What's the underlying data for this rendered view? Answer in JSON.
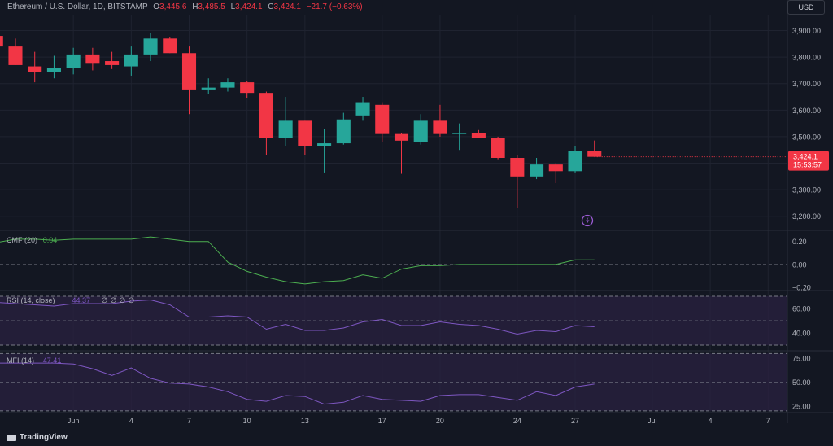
{
  "header": {
    "symbol": "Ethereum / U.S. Dollar, 1D, BITSTAMP",
    "o_label": "O",
    "o": "3,445.6",
    "h_label": "H",
    "h": "3,485.5",
    "l_label": "L",
    "l": "3,424.1",
    "c_label": "C",
    "c": "3,424.1",
    "change": "−21.7 (−0.63%)"
  },
  "currency_button": "USD",
  "branding": "TradingView",
  "price_tag": {
    "price": "3,424.1",
    "countdown": "15:53:57"
  },
  "colors": {
    "up": "#26a69a",
    "down": "#f23645",
    "bg": "#131722",
    "grid": "#1f2330",
    "text": "#b2b5be",
    "indicator_line": "#7e57c2",
    "cmf_line": "#4caf50",
    "band_fill": "#2a2140"
  },
  "chart_data": [
    {
      "type": "candlestick",
      "title": "Ethereum / U.S. Dollar, 1D, BITSTAMP",
      "ylim": [
        3150,
        3960
      ],
      "y_ticks": [
        3200,
        3300,
        3400,
        3500,
        3600,
        3700,
        3800,
        3900
      ],
      "y_tick_labels": [
        "3,200.00",
        "3,300.00",
        "3,400.00",
        "3,500.00",
        "3,600.00",
        "3,700.00",
        "3,800.00",
        "3,900.00"
      ],
      "x_tick_labels": [
        {
          "day": 1,
          "label": "Jun"
        },
        {
          "day": 4,
          "label": "4"
        },
        {
          "day": 7,
          "label": "7"
        },
        {
          "day": 10,
          "label": "10"
        },
        {
          "day": 13,
          "label": "13"
        },
        {
          "day": 17,
          "label": "17"
        },
        {
          "day": 20,
          "label": "20"
        },
        {
          "day": 24,
          "label": "24"
        },
        {
          "day": 27,
          "label": "27"
        },
        {
          "day": 31,
          "label": "Jul"
        },
        {
          "day": 34,
          "label": "4"
        },
        {
          "day": 37,
          "label": "7"
        }
      ],
      "x_range_days": [
        -2.8,
        38
      ],
      "candles": [
        {
          "day": -3,
          "o": 3880,
          "h": 3900,
          "l": 3830,
          "c": 3840
        },
        {
          "day": -2,
          "o": 3840,
          "h": 3870,
          "l": 3770,
          "c": 3770
        },
        {
          "day": -1,
          "o": 3765,
          "h": 3820,
          "l": 3705,
          "c": 3745
        },
        {
          "day": 0,
          "o": 3745,
          "h": 3805,
          "l": 3720,
          "c": 3760
        },
        {
          "day": 1,
          "o": 3760,
          "h": 3835,
          "l": 3735,
          "c": 3810
        },
        {
          "day": 2,
          "o": 3810,
          "h": 3835,
          "l": 3750,
          "c": 3775
        },
        {
          "day": 3,
          "o": 3785,
          "h": 3820,
          "l": 3755,
          "c": 3770
        },
        {
          "day": 4,
          "o": 3765,
          "h": 3840,
          "l": 3730,
          "c": 3810
        },
        {
          "day": 5,
          "o": 3810,
          "h": 3890,
          "l": 3785,
          "c": 3870
        },
        {
          "day": 6,
          "o": 3870,
          "h": 3875,
          "l": 3815,
          "c": 3815
        },
        {
          "day": 7,
          "o": 3815,
          "h": 3840,
          "l": 3585,
          "c": 3678
        },
        {
          "day": 8,
          "o": 3678,
          "h": 3720,
          "l": 3660,
          "c": 3685
        },
        {
          "day": 9,
          "o": 3685,
          "h": 3720,
          "l": 3670,
          "c": 3705
        },
        {
          "day": 10,
          "o": 3705,
          "h": 3710,
          "l": 3645,
          "c": 3665
        },
        {
          "day": 11,
          "o": 3665,
          "h": 3670,
          "l": 3430,
          "c": 3495
        },
        {
          "day": 12,
          "o": 3495,
          "h": 3650,
          "l": 3465,
          "c": 3560
        },
        {
          "day": 13,
          "o": 3560,
          "h": 3560,
          "l": 3430,
          "c": 3465
        },
        {
          "day": 14,
          "o": 3465,
          "h": 3530,
          "l": 3365,
          "c": 3475
        },
        {
          "day": 15,
          "o": 3475,
          "h": 3590,
          "l": 3470,
          "c": 3565
        },
        {
          "day": 16,
          "o": 3580,
          "h": 3650,
          "l": 3560,
          "c": 3630
        },
        {
          "day": 17,
          "o": 3620,
          "h": 3630,
          "l": 3480,
          "c": 3510
        },
        {
          "day": 18,
          "o": 3510,
          "h": 3515,
          "l": 3360,
          "c": 3485
        },
        {
          "day": 19,
          "o": 3480,
          "h": 3585,
          "l": 3470,
          "c": 3560
        },
        {
          "day": 20,
          "o": 3560,
          "h": 3620,
          "l": 3500,
          "c": 3510
        },
        {
          "day": 21,
          "o": 3510,
          "h": 3550,
          "l": 3450,
          "c": 3515
        },
        {
          "day": 22,
          "o": 3515,
          "h": 3525,
          "l": 3495,
          "c": 3495
        },
        {
          "day": 23,
          "o": 3495,
          "h": 3500,
          "l": 3415,
          "c": 3420
        },
        {
          "day": 24,
          "o": 3420,
          "h": 3430,
          "l": 3230,
          "c": 3350
        },
        {
          "day": 25,
          "o": 3350,
          "h": 3420,
          "l": 3340,
          "c": 3395
        },
        {
          "day": 26,
          "o": 3395,
          "h": 3400,
          "l": 3325,
          "c": 3370
        },
        {
          "day": 27,
          "o": 3370,
          "h": 3465,
          "l": 3365,
          "c": 3445
        },
        {
          "day": 28,
          "o": 3445.6,
          "h": 3485.5,
          "l": 3424.1,
          "c": 3424.1
        }
      ]
    },
    {
      "type": "line",
      "title": "CMF (20)",
      "value_label": "0.04",
      "ylim": [
        -0.22,
        0.29
      ],
      "y_ticks": [
        0.2,
        0,
        -0.2
      ],
      "y_tick_labels": [
        "0.20",
        "0.00",
        "−0.20"
      ],
      "x": [
        -3,
        -2,
        -1,
        0,
        1,
        2,
        3,
        4,
        5,
        6,
        7,
        8,
        9,
        10,
        11,
        12,
        13,
        14,
        15,
        16,
        17,
        18,
        19,
        20,
        21,
        22,
        23,
        24,
        25,
        26,
        27,
        28
      ],
      "values": [
        0.19,
        0.22,
        0.22,
        0.21,
        0.22,
        0.22,
        0.22,
        0.22,
        0.24,
        0.22,
        0.2,
        0.2,
        0.02,
        -0.06,
        -0.11,
        -0.15,
        -0.17,
        -0.15,
        -0.14,
        -0.09,
        -0.12,
        -0.04,
        -0.01,
        -0.01,
        0.0,
        0.0,
        0.0,
        0.0,
        0.0,
        0.0,
        0.04,
        0.04
      ]
    },
    {
      "type": "line",
      "title": "RSI (14, close)",
      "value_label": "44.37",
      "na_labels": [
        "∅",
        "∅",
        "∅",
        "∅"
      ],
      "ylim": [
        26,
        74
      ],
      "y_ticks": [
        60,
        40
      ],
      "y_tick_labels": [
        "60.00",
        "40.00"
      ],
      "band": [
        30,
        70
      ],
      "x": [
        -3,
        -2,
        -1,
        0,
        1,
        2,
        3,
        4,
        5,
        6,
        7,
        8,
        9,
        10,
        11,
        12,
        13,
        14,
        15,
        16,
        17,
        18,
        19,
        20,
        21,
        22,
        23,
        24,
        25,
        26,
        27,
        28
      ],
      "values": [
        65,
        64,
        63,
        62,
        64,
        64,
        64,
        66,
        67,
        63,
        53,
        53,
        54,
        53,
        43,
        47,
        42,
        42,
        44,
        49,
        51,
        46,
        46,
        49,
        47,
        46,
        43,
        39,
        42,
        41,
        46,
        45
      ]
    },
    {
      "type": "line",
      "title": "MFI (14)",
      "value_label": "47.41",
      "ylim": [
        19,
        82
      ],
      "y_ticks": [
        75,
        50,
        25
      ],
      "y_tick_labels": [
        "75.00",
        "50.00",
        "25.00"
      ],
      "band": [
        20,
        80
      ],
      "x": [
        -3,
        -2,
        -1,
        0,
        1,
        2,
        3,
        4,
        5,
        6,
        7,
        8,
        9,
        10,
        11,
        12,
        13,
        14,
        15,
        16,
        17,
        18,
        19,
        20,
        21,
        22,
        23,
        24,
        25,
        26,
        27,
        28
      ],
      "values": [
        70,
        70,
        70,
        70,
        69,
        64,
        57,
        65,
        54,
        49,
        48,
        45,
        40,
        32,
        30,
        36,
        35,
        27,
        29,
        36,
        32,
        31,
        30,
        36,
        37,
        37,
        34,
        31,
        40,
        36,
        45,
        48
      ]
    }
  ]
}
